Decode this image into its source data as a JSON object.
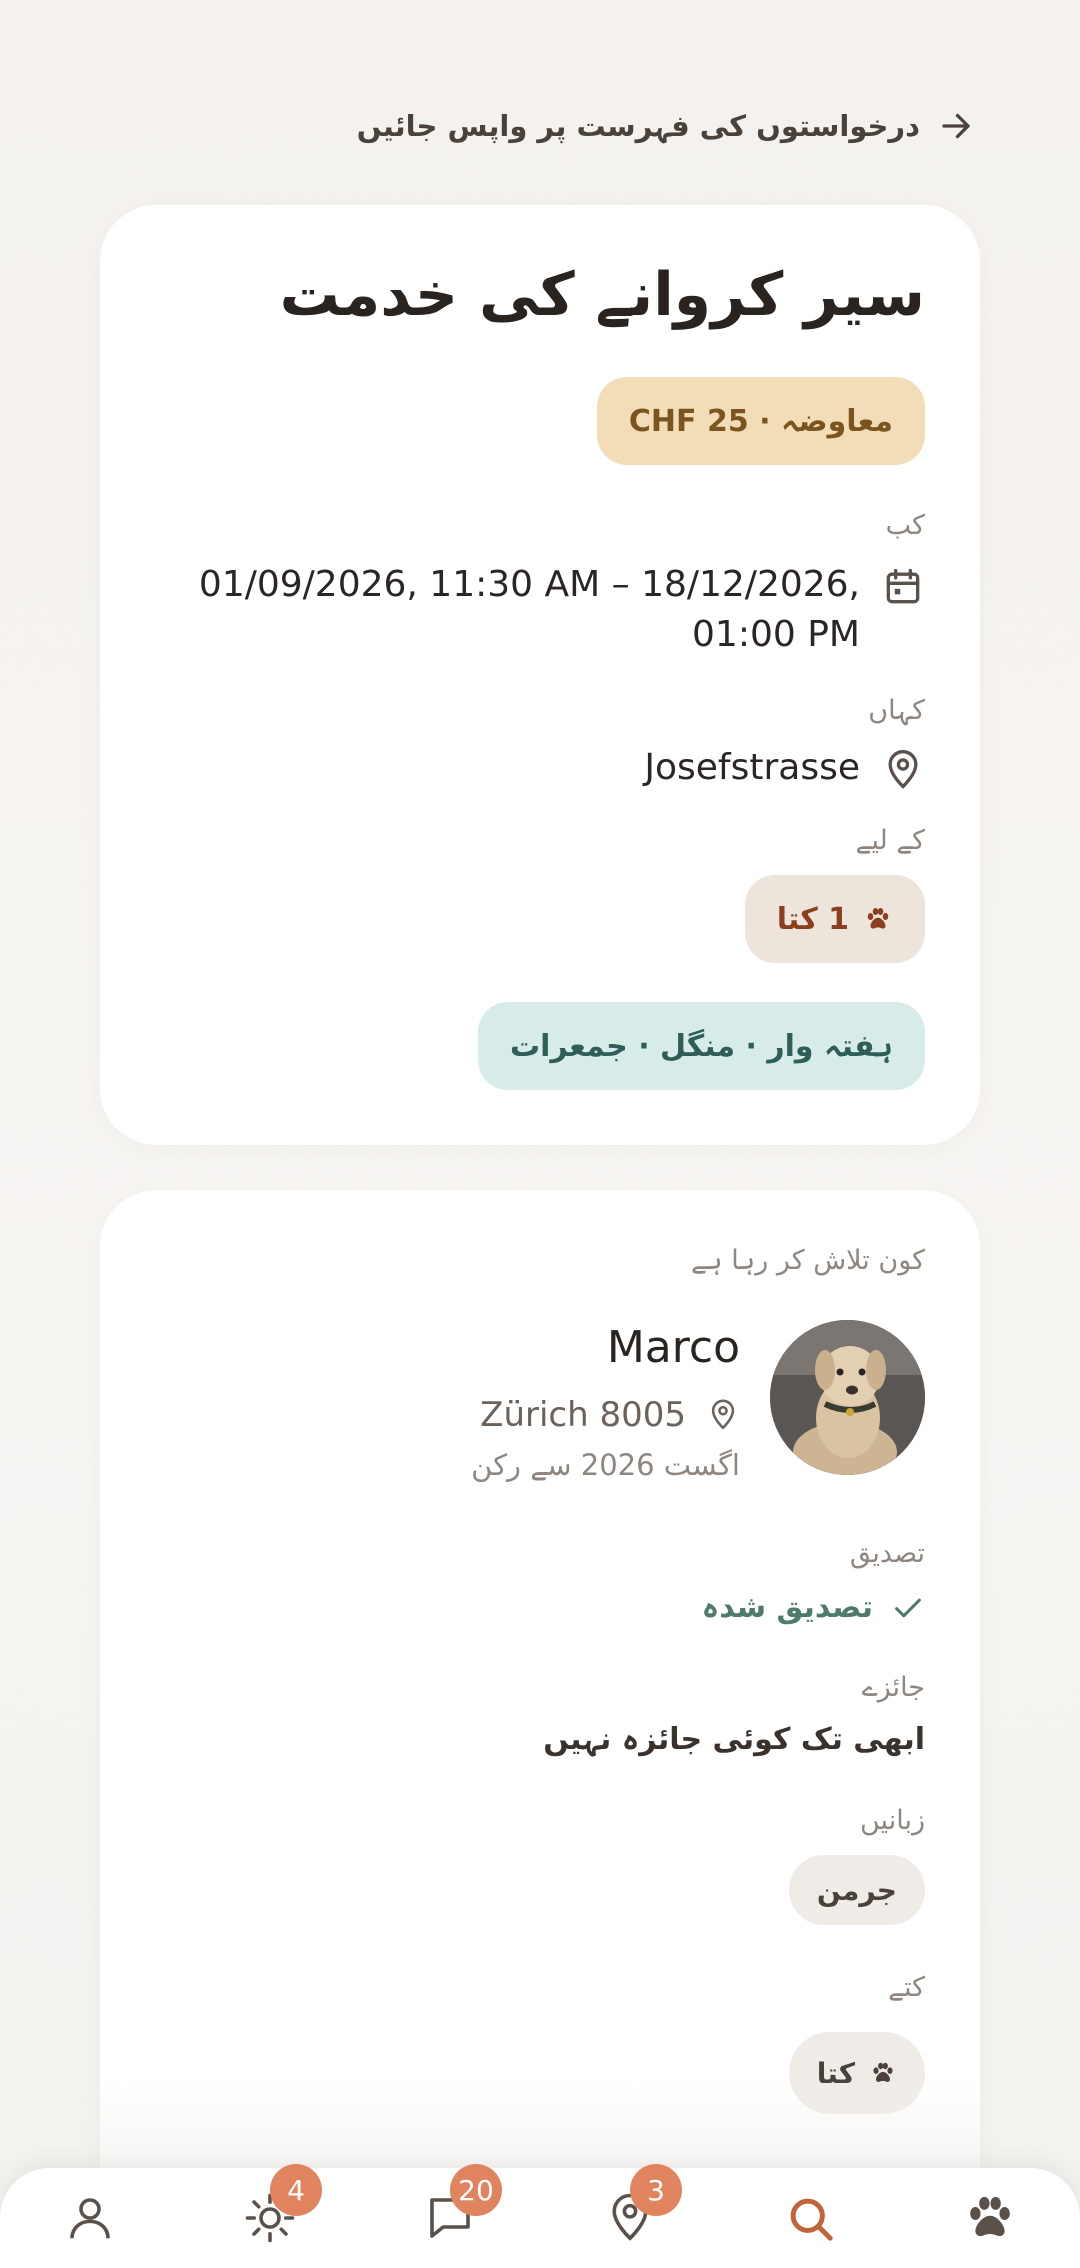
{
  "back_link": "درخواستوں کی فہرست پر واپس جائیں",
  "request": {
    "title": "سیر کروانے کی خدمت",
    "price_pill": "معاوضہ · CHF 25",
    "when_label": "کب",
    "when_value": "01/09/2026, 11:30 AM – 18/12/2026, 01:00 PM",
    "where_label": "کہاں",
    "where_value": "Josefstrasse",
    "for_label": "کے لیے",
    "for_value": "1 کتا",
    "frequency": "ہفتہ وار · منگل · جمعرات"
  },
  "owner": {
    "section_label": "کون تلاش کر رہا ہے",
    "name": "Marco",
    "location": "Zürich 8005",
    "member_since": "اگست 2026 سے رکن",
    "verification_label": "تصدیق",
    "verification_value": "تصدیق شدہ",
    "reviews_label": "جائزے",
    "reviews_value": "ابھی تک کوئی جائزہ نہیں",
    "languages_label": "زبانیں",
    "languages": [
      "جرمن"
    ],
    "dogs_label": "کتے",
    "dogs": [
      "کتا"
    ]
  },
  "nav": [
    {
      "icon": "person-icon",
      "badge": ""
    },
    {
      "icon": "sun-icon",
      "badge": "4"
    },
    {
      "icon": "chat-icon",
      "badge": "20"
    },
    {
      "icon": "location-pin-icon",
      "badge": "3"
    },
    {
      "icon": "search-icon",
      "badge": ""
    },
    {
      "icon": "paw-icon",
      "badge": ""
    }
  ],
  "colors": {
    "accent": "#e0835f",
    "price_pill_bg": "#f3ddb8",
    "freq_pill_bg": "#d7ebe8",
    "verified_green": "#4f7a6e"
  }
}
